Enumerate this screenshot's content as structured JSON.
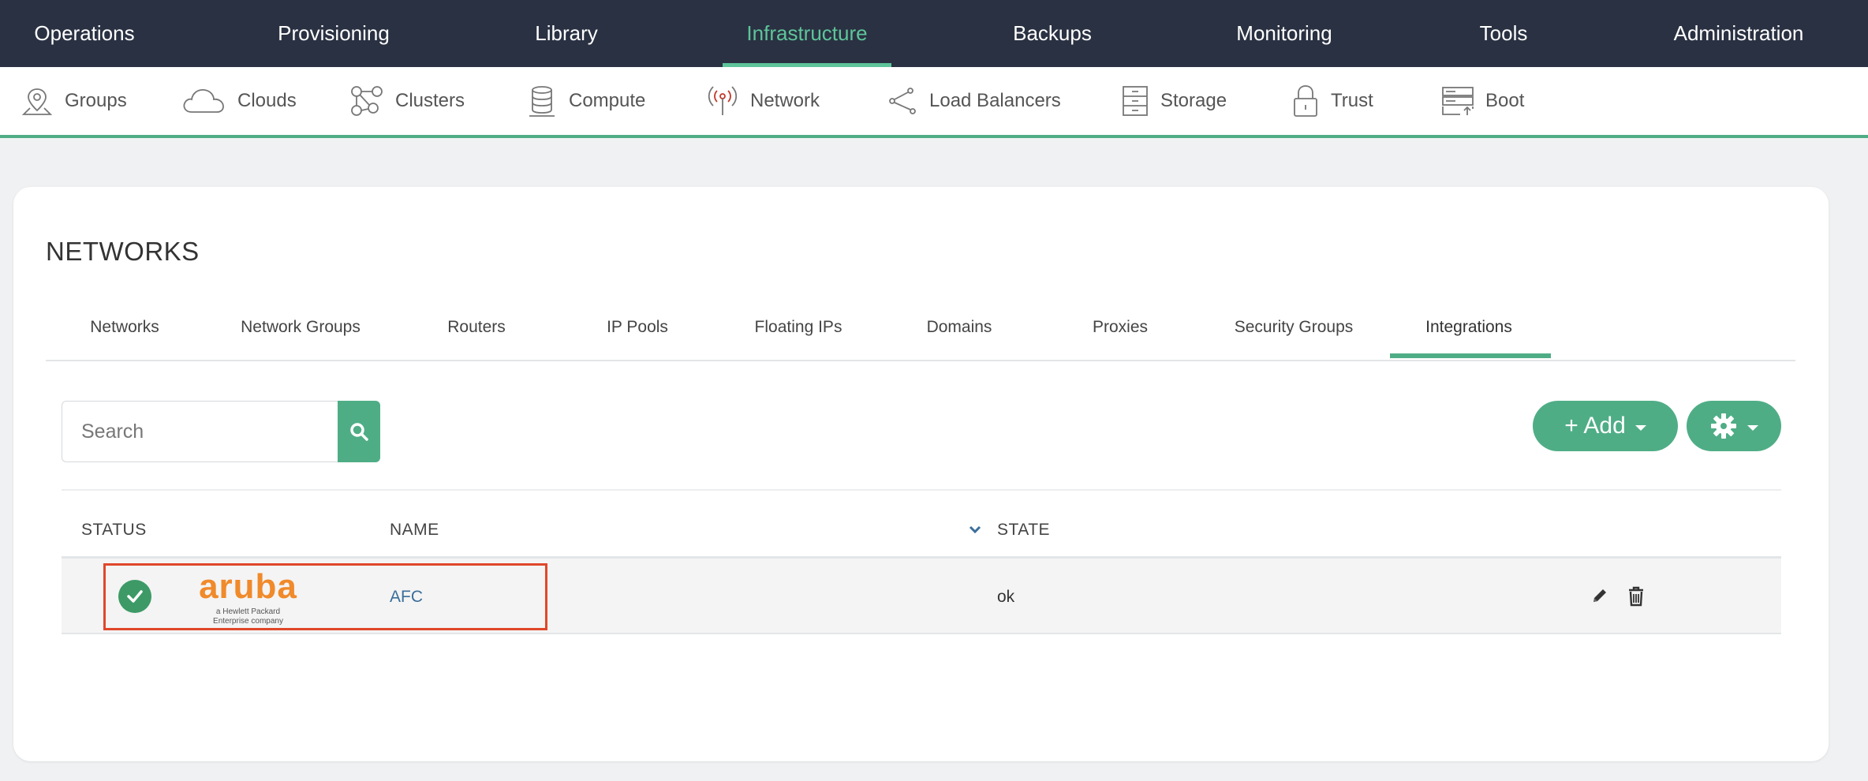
{
  "topnav": {
    "items": [
      {
        "label": "Operations"
      },
      {
        "label": "Provisioning"
      },
      {
        "label": "Library"
      },
      {
        "label": "Infrastructure",
        "active": true
      },
      {
        "label": "Backups"
      },
      {
        "label": "Monitoring"
      },
      {
        "label": "Tools"
      },
      {
        "label": "Administration"
      }
    ]
  },
  "subnav": {
    "items": [
      {
        "label": "Groups",
        "icon": "location-pin-icon"
      },
      {
        "label": "Clouds",
        "icon": "cloud-icon"
      },
      {
        "label": "Clusters",
        "icon": "clusters-icon"
      },
      {
        "label": "Compute",
        "icon": "database-icon"
      },
      {
        "label": "Network",
        "icon": "antenna-icon",
        "active": true
      },
      {
        "label": "Load Balancers",
        "icon": "share-nodes-icon"
      },
      {
        "label": "Storage",
        "icon": "storage-cabinet-icon"
      },
      {
        "label": "Trust",
        "icon": "lock-icon"
      },
      {
        "label": "Boot",
        "icon": "server-upload-icon"
      }
    ]
  },
  "page": {
    "title": "NETWORKS"
  },
  "tabs": [
    {
      "label": "Networks"
    },
    {
      "label": "Network Groups"
    },
    {
      "label": "Routers"
    },
    {
      "label": "IP Pools"
    },
    {
      "label": "Floating IPs"
    },
    {
      "label": "Domains"
    },
    {
      "label": "Proxies"
    },
    {
      "label": "Security Groups"
    },
    {
      "label": "Integrations",
      "active": true
    }
  ],
  "search": {
    "placeholder": "Search",
    "value": ""
  },
  "toolbar": {
    "add_label": "+ Add"
  },
  "table": {
    "columns": [
      "STATUS",
      "NAME",
      "STATE"
    ],
    "rows": [
      {
        "status": "ok",
        "logo_text": "aruba",
        "logo_sub1": "a Hewlett Packard",
        "logo_sub2": "Enterprise company",
        "name": "AFC",
        "state": "ok"
      }
    ]
  },
  "colors": {
    "topnav_bg": "#2a3142",
    "accent": "#4fad86",
    "active_text": "#5ec49a",
    "status_ok": "#3d9a66",
    "aruba_orange": "#f08a2a",
    "highlight": "#e0472a",
    "link": "#3b6e9a"
  }
}
